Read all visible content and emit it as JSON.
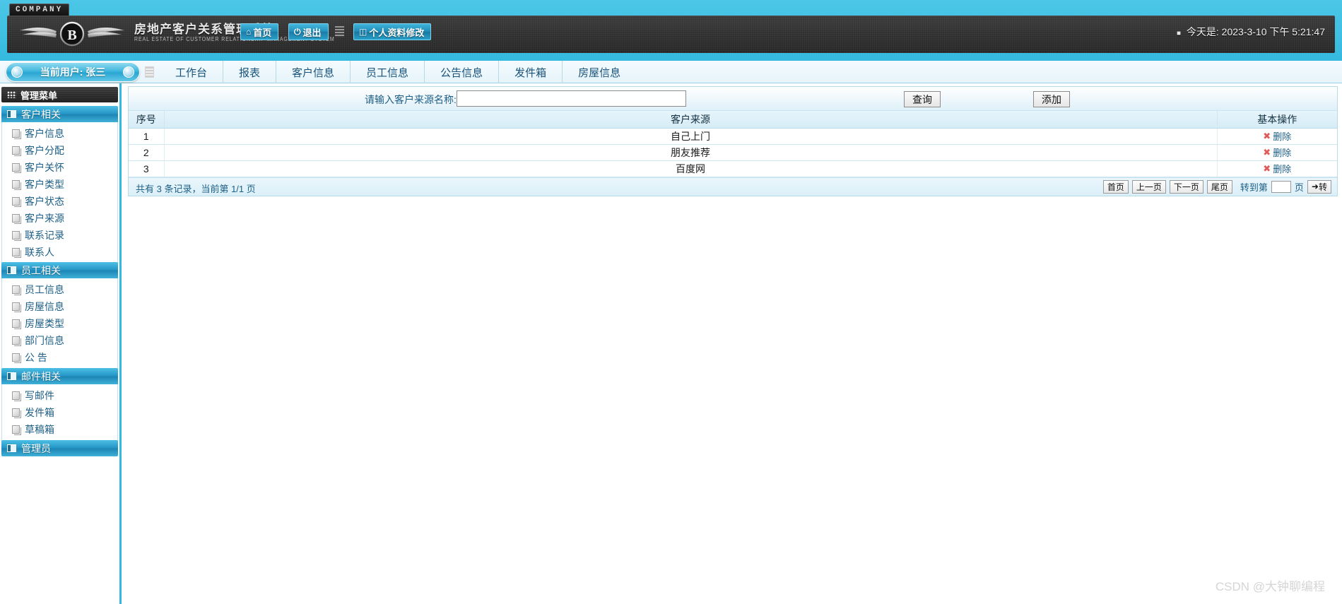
{
  "header": {
    "company_tag": "COMPANY",
    "brand_title": "房地产客户关系管理系统",
    "brand_subtitle": "REAL ESTATE OF CUSTOMER RELATIONSHIP MANAGEMENT SYSTEM",
    "home_button": "首页",
    "logout_button": "退出",
    "profile_button": "个人资料修改",
    "today_label": "今天是:",
    "today_value": "2023-3-10 下午 5:21:47",
    "accent_color": "#35b9df"
  },
  "navbar": {
    "current_user": "当前用户: 张三",
    "tabs": [
      {
        "label": "工作台"
      },
      {
        "label": "报表"
      },
      {
        "label": "客户信息"
      },
      {
        "label": "员工信息"
      },
      {
        "label": "公告信息"
      },
      {
        "label": "发件箱"
      },
      {
        "label": "房屋信息"
      }
    ]
  },
  "sidebar": {
    "title": "管理菜单",
    "groups": [
      {
        "label": "客户相关",
        "items": [
          {
            "label": "客户信息"
          },
          {
            "label": "客户分配"
          },
          {
            "label": "客户关怀"
          },
          {
            "label": "客户类型"
          },
          {
            "label": "客户状态"
          },
          {
            "label": "客户来源"
          },
          {
            "label": "联系记录"
          },
          {
            "label": "联系人"
          }
        ]
      },
      {
        "label": "员工相关",
        "items": [
          {
            "label": "员工信息"
          },
          {
            "label": "房屋信息"
          },
          {
            "label": "房屋类型"
          },
          {
            "label": "部门信息"
          },
          {
            "label": "公  告"
          }
        ]
      },
      {
        "label": "邮件相关",
        "items": [
          {
            "label": "写邮件"
          },
          {
            "label": "发件箱"
          },
          {
            "label": "草稿箱"
          }
        ]
      },
      {
        "label": "管理员",
        "items": []
      }
    ]
  },
  "main": {
    "search_label": "请输入客户来源名称:",
    "search_value": "",
    "search_placeholder": "",
    "query_button": "查询",
    "add_button": "添加",
    "table": {
      "columns": [
        "序号",
        "客户来源",
        "基本操作"
      ],
      "rows": [
        {
          "no": "1",
          "source": "自己上门",
          "action": "删除"
        },
        {
          "no": "2",
          "source": "朋友推荐",
          "action": "删除"
        },
        {
          "no": "3",
          "source": "百度网",
          "action": "删除"
        }
      ]
    },
    "pager": {
      "info": "共有 3 条记录，当前第 1/1 页",
      "first": "首页",
      "prev": "上一页",
      "next": "下一页",
      "last": "尾页",
      "goto_prefix": "转到第",
      "goto_value": "",
      "goto_suffix": "页",
      "go_button": "转"
    }
  },
  "watermark": "CSDN @大钟聊编程"
}
